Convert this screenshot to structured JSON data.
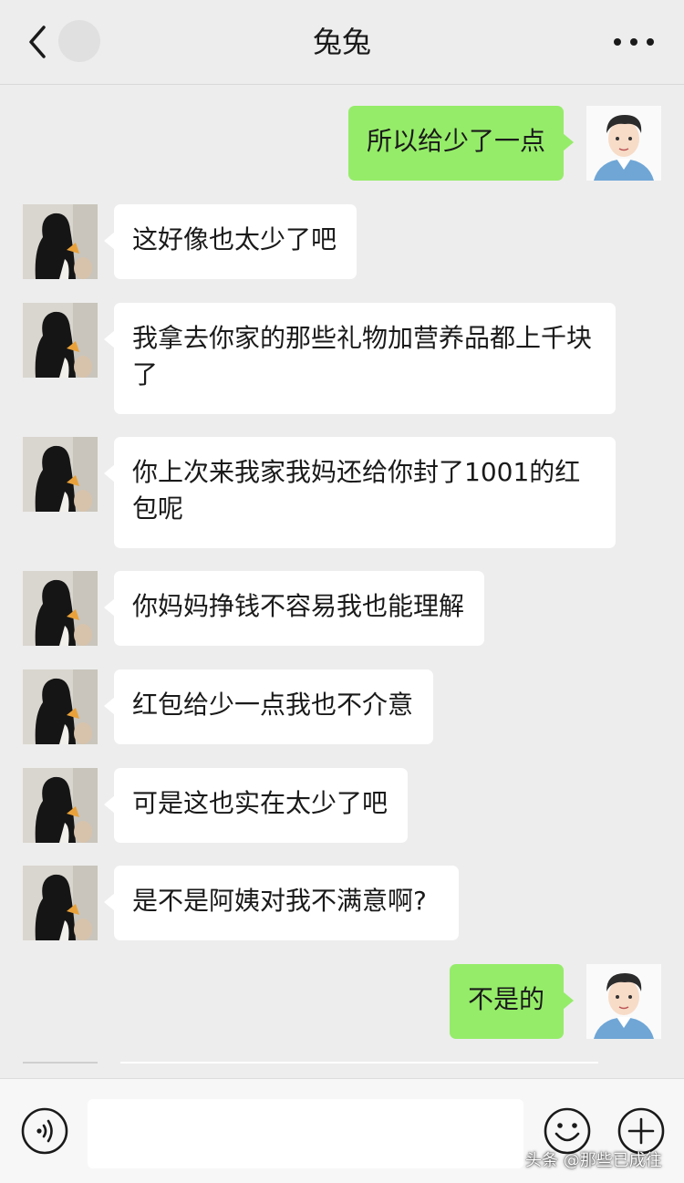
{
  "header": {
    "title": "兔兔"
  },
  "messages": [
    {
      "side": "right",
      "text": "所以给少了一点"
    },
    {
      "side": "left",
      "text": "这好像也太少了吧"
    },
    {
      "side": "left",
      "text": "我拿去你家的那些礼物加营养品都上千块了"
    },
    {
      "side": "left",
      "text": "你上次来我家我妈还给你封了1001的红包呢"
    },
    {
      "side": "left",
      "text": "你妈妈挣钱不容易我也能理解"
    },
    {
      "side": "left",
      "text": "红包给少一点我也不介意"
    },
    {
      "side": "left",
      "text": "可是这也实在太少了吧"
    },
    {
      "side": "left",
      "text": "是不是阿姨对我不满意啊?"
    },
    {
      "side": "right",
      "text": "不是的"
    }
  ],
  "input": {
    "value": "",
    "placeholder": ""
  },
  "icons": {
    "back": "chevron-left-icon",
    "more": "more-dots-icon",
    "voice": "voice-icon",
    "emoji": "emoji-icon",
    "plus": "plus-icon"
  },
  "colors": {
    "background": "#ededed",
    "sent_bubble": "#95ec69",
    "received_bubble": "#ffffff"
  },
  "watermark": "头条 @那些已成往"
}
